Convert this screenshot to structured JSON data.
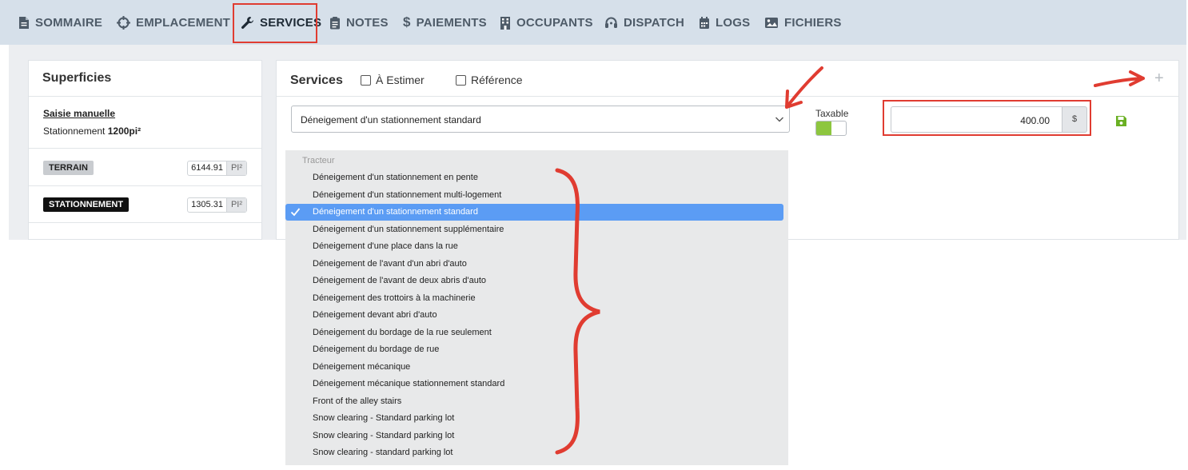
{
  "tabs": [
    {
      "label": "SOMMAIRE",
      "icon": "document-icon"
    },
    {
      "label": "EMPLACEMENT",
      "icon": "crosshair-icon"
    },
    {
      "label": "SERVICES",
      "icon": "wrench-icon",
      "active": true
    },
    {
      "label": "NOTES",
      "icon": "clipboard-icon"
    },
    {
      "label": "PAIEMENTS",
      "icon": "dollar-icon"
    },
    {
      "label": "OCCUPANTS",
      "icon": "building-icon"
    },
    {
      "label": "DISPATCH",
      "icon": "headset-icon"
    },
    {
      "label": "LOGS",
      "icon": "calendar-icon"
    },
    {
      "label": "FICHIERS",
      "icon": "image-icon"
    }
  ],
  "superficies": {
    "title": "Superficies",
    "manual_link": "Saisie manuelle",
    "manual_label": "Stationnement",
    "manual_value": "1200pi²",
    "rows": [
      {
        "badge": "TERRAIN",
        "value": "6144.91",
        "unit": "PI²"
      },
      {
        "badge": "STATIONNEMENT",
        "value": "1305.31",
        "unit": "PI²"
      }
    ]
  },
  "services": {
    "title": "Services",
    "checkbox_estimer": "À Estimer",
    "checkbox_reference": "Référence",
    "selected": "Déneigement d'un stationnement standard",
    "taxable_label": "Taxable",
    "taxable": true,
    "price": "400.00",
    "currency": "$",
    "add_symbol": "+"
  },
  "dropdown": {
    "group": "Tracteur",
    "options": [
      "Déneigement d'un stationnement en pente",
      "Déneigement d'un stationnement multi-logement",
      "Déneigement d'un stationnement standard",
      "Déneigement d'un stationnement supplémentaire",
      "Déneigement d'une place dans la rue",
      "Déneigement de l'avant d'un abri d'auto",
      "Déneigement de l'avant de deux abris d'auto",
      "Déneigement des trottoirs à la machinerie",
      "Déneigement devant abri d'auto",
      "Déneigement du bordage de la rue seulement",
      "Déneigement du bordage de rue",
      "Déneigement mécanique",
      "Déneigement mécanique stationnement standard",
      "Front of the alley stairs",
      "Snow clearing - Standard parking lot",
      "Snow clearing - Standard parking lot",
      "Snow clearing - standard parking lot"
    ],
    "selected_index": 2
  },
  "colors": {
    "accent_red": "#e03c31",
    "toggle_green": "#8dc63f",
    "selection_blue": "#5b9cf4"
  }
}
